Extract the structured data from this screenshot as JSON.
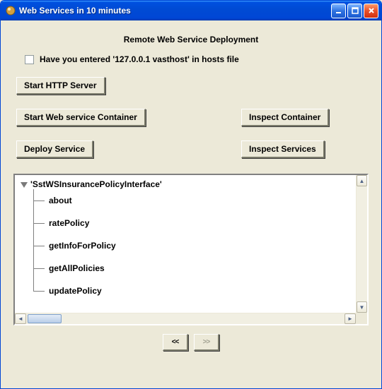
{
  "window": {
    "title": "Web Services in 10 minutes"
  },
  "heading": "Remote Web Service Deployment",
  "checkbox_label": "Have you entered  '127.0.0.1  vasthost' in hosts file",
  "buttons": {
    "start_http": "Start HTTP Server",
    "start_container": "Start Web service Container",
    "inspect_container": "Inspect Container",
    "deploy_service": "Deploy Service",
    "inspect_services": "Inspect Services"
  },
  "tree": {
    "root": "'SstWSInsurancePolicyInterface'",
    "children": [
      "about",
      "ratePolicy",
      "getInfoForPolicy",
      "getAllPolicies",
      "updatePolicy"
    ]
  },
  "nav": {
    "prev": "<<",
    "next": ">>"
  }
}
